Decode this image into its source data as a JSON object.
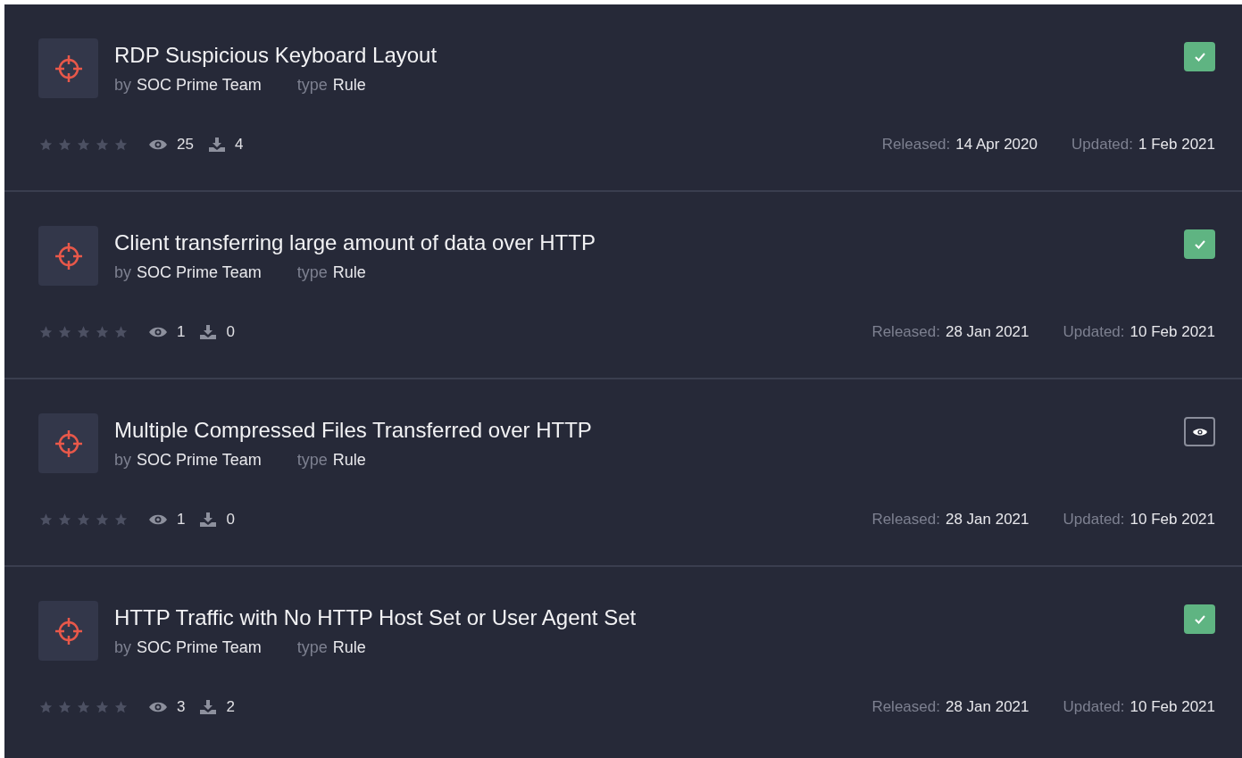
{
  "rules": [
    {
      "title": "RDP Suspicious Keyboard Layout",
      "by_label": "by",
      "author": "SOC Prime Team",
      "type_label": "type",
      "type": "Rule",
      "stars": 0,
      "views": "25",
      "downloads": "4",
      "released_label": "Released:",
      "released": "14 Apr 2020",
      "updated_label": "Updated:",
      "updated": "1 Feb 2021",
      "kind": "checked"
    },
    {
      "title": "Client transferring large amount of data over HTTP",
      "by_label": "by",
      "author": "SOC Prime Team",
      "type_label": "type",
      "type": "Rule",
      "stars": 0,
      "views": "1",
      "downloads": "0",
      "released_label": "Released:",
      "released": "28 Jan 2021",
      "updated_label": "Updated:",
      "updated": "10 Feb 2021",
      "kind": "checked"
    },
    {
      "title": "Multiple Compressed Files Transferred over HTTP",
      "by_label": "by",
      "author": "SOC Prime Team",
      "type_label": "type",
      "type": "Rule",
      "stars": 0,
      "views": "1",
      "downloads": "0",
      "released_label": "Released:",
      "released": "28 Jan 2021",
      "updated_label": "Updated:",
      "updated": "10 Feb 2021",
      "kind": "view"
    },
    {
      "title": "HTTP Traffic with No HTTP Host Set or User Agent Set",
      "by_label": "by",
      "author": "SOC Prime Team",
      "type_label": "type",
      "type": "Rule",
      "stars": 0,
      "views": "3",
      "downloads": "2",
      "released_label": "Released:",
      "released": "28 Jan 2021",
      "updated_label": "Updated:",
      "updated": "10 Feb 2021",
      "kind": "checked"
    }
  ]
}
